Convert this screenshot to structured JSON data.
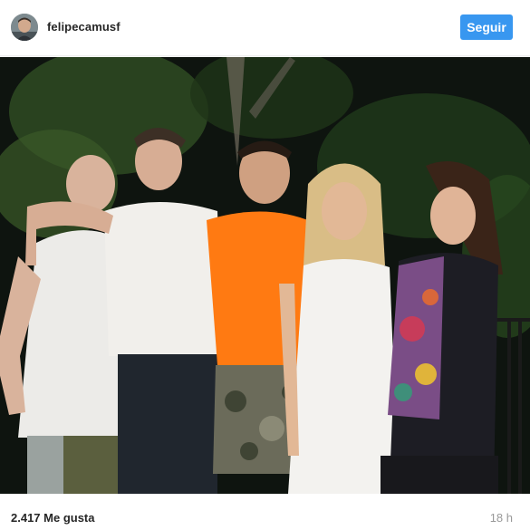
{
  "header": {
    "username": "felipecamusf",
    "follow_label": "Seguir"
  },
  "footer": {
    "likes": "2.417 Me gusta",
    "timestamp": "18 h"
  },
  "colors": {
    "follow_button": "#3897f0",
    "username_text": "#262626",
    "timestamp_text": "#999999"
  }
}
